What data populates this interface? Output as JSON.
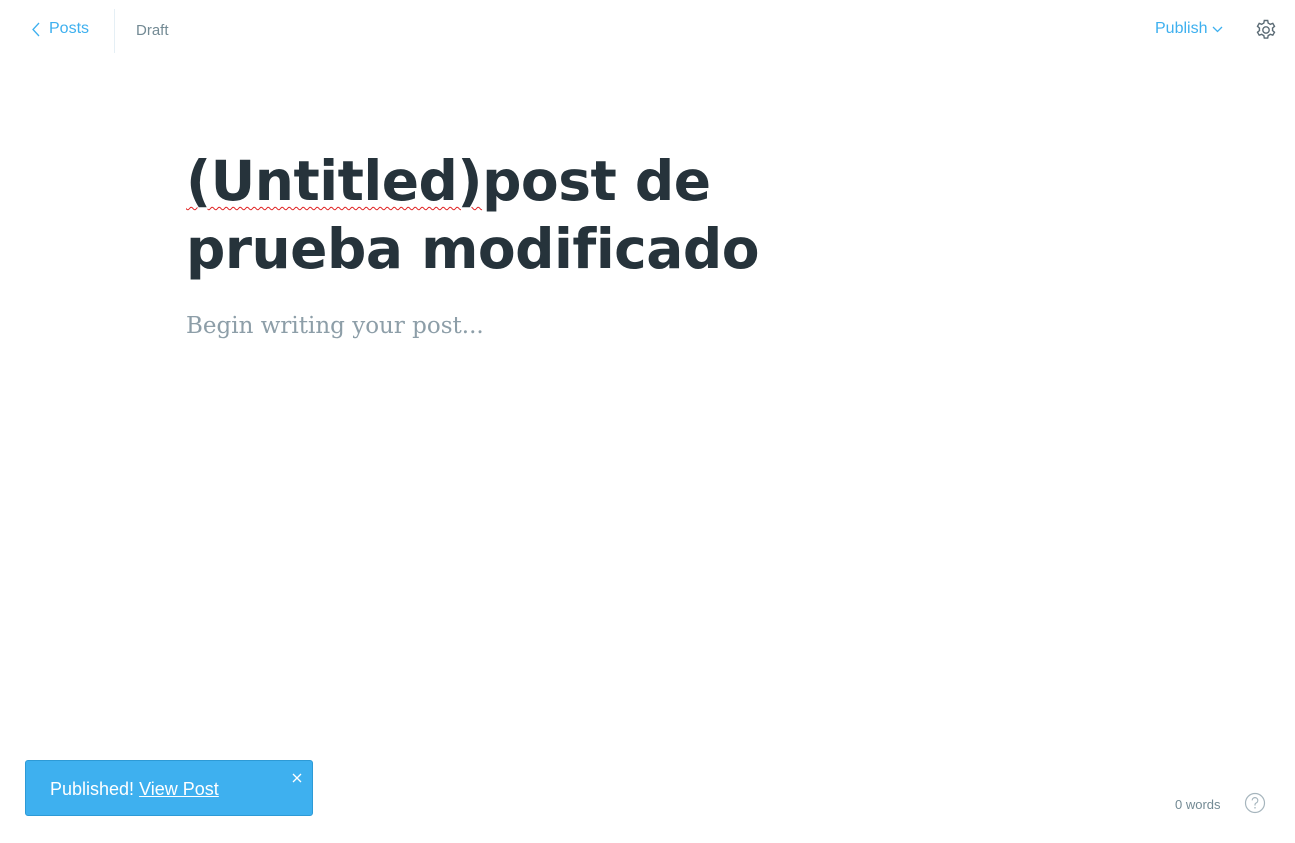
{
  "header": {
    "back_label": "Posts",
    "status": "Draft",
    "publish_label": "Publish",
    "icons": [
      "chevron-left-icon",
      "chevron-down-icon",
      "gear-icon"
    ]
  },
  "editor": {
    "title_misspelled": "(Untitled)",
    "title_rest": "post de prueba modificado",
    "body_placeholder": "Begin writing your post..."
  },
  "notification": {
    "message": "Published!",
    "link_label": "View Post",
    "close_icon": "close-icon"
  },
  "footer": {
    "word_count": "0 words",
    "help_icon": "help-icon"
  },
  "colors": {
    "accent": "#3eb0ef",
    "title": "#26333b",
    "muted": "#738a94",
    "placeholder": "#8d9ea8"
  }
}
